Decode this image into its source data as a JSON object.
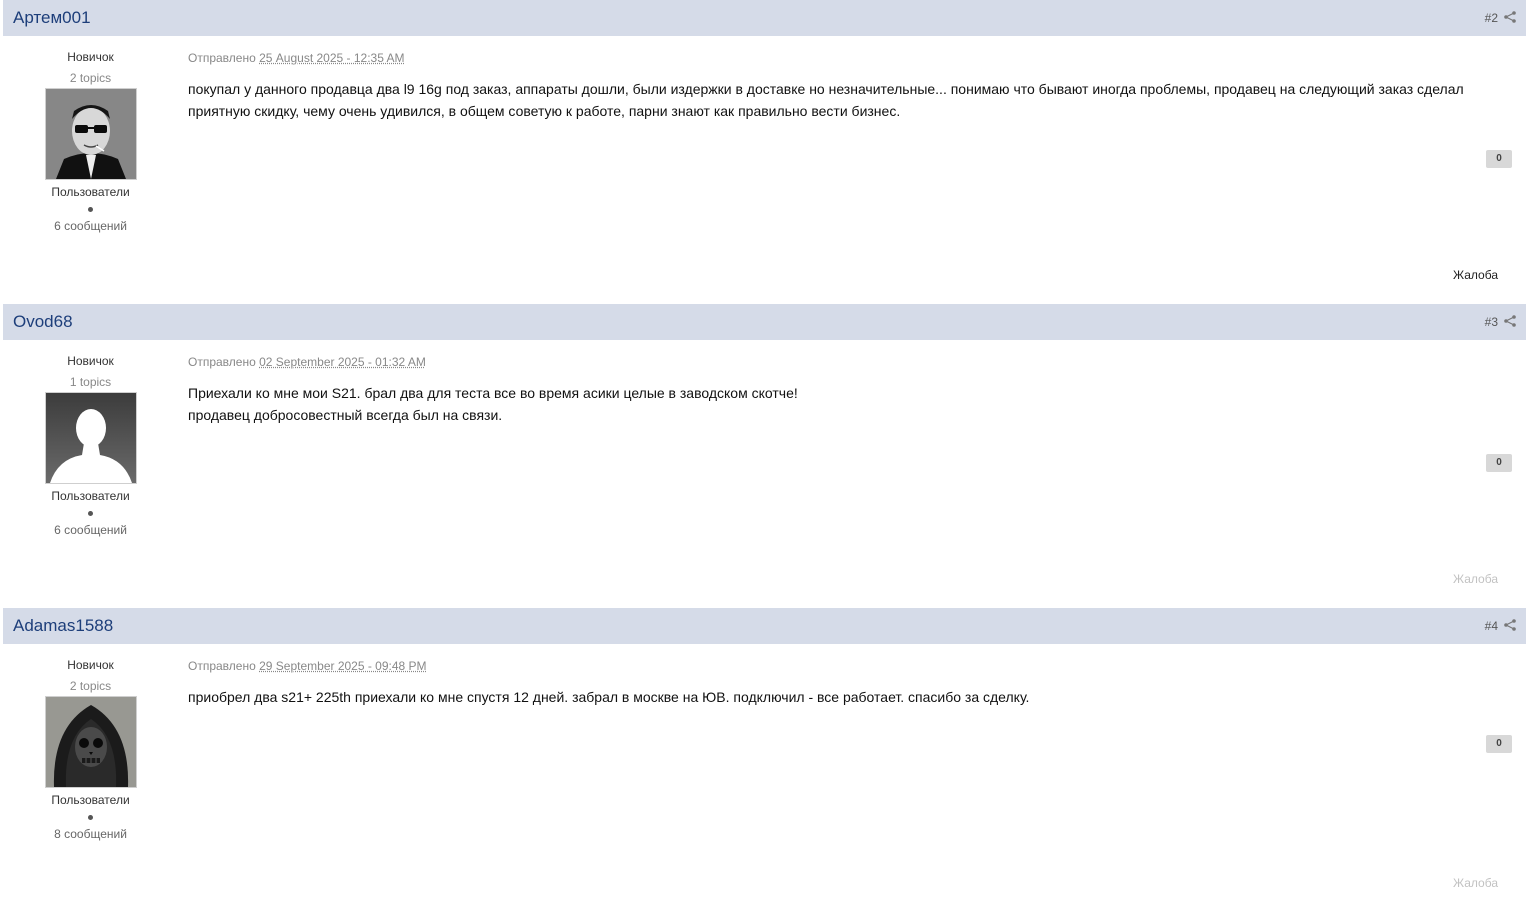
{
  "posts": [
    {
      "author": "Артем001",
      "post_number": "#2",
      "rank": "Новичок",
      "topics": "2 topics",
      "group": "Пользователи",
      "post_count": "6 сообщений",
      "posted_label": "Отправлено",
      "posted_date": "25 August 2025 - 12:35 AM",
      "body": [
        "покупал у данного продавца два l9 16g под заказ, аппараты дошли, были издержки в доставке но незначительные... понимаю что бывают иногда проблемы, продавец на следующий заказ сделал приятную скидку, чему очень удивился, в общем советую к работе, парни знают как правильно вести бизнес."
      ],
      "reputation": "0",
      "report_label": "Жалоба",
      "avatar_icon": "avatar-man-sunglasses"
    },
    {
      "author": "Ovod68",
      "post_number": "#3",
      "rank": "Новичок",
      "topics": "1 topics",
      "group": "Пользователи",
      "post_count": "6 сообщений",
      "posted_label": "Отправлено",
      "posted_date": "02 September 2025 - 01:32 AM",
      "body": [
        "Приехали ко мне мои S21. брал два для теста все во время асики целые в заводском скотче!",
        "продавец добросовестный всегда был на связи."
      ],
      "reputation": "0",
      "report_label": "Жалоба",
      "avatar_icon": "default-avatar-silhouette"
    },
    {
      "author": "Adamas1588",
      "post_number": "#4",
      "rank": "Новичок",
      "topics": "2 topics",
      "group": "Пользователи",
      "post_count": "8 сообщений",
      "posted_label": "Отправлено",
      "posted_date": "29 September 2025 - 09:48 PM",
      "body": [
        "приобрел два s21+ 225th приехали ко мне спустя 12 дней. забрал в москве на ЮВ. подключил - все работает. спасибо за сделку."
      ],
      "reputation": "0",
      "report_label": "Жалоба",
      "avatar_icon": "avatar-hooded-skull"
    }
  ],
  "colors": {
    "header_bg": "#d5dbe8",
    "author_link": "#1d3e7a",
    "report_faded": "#c2c2c2"
  }
}
